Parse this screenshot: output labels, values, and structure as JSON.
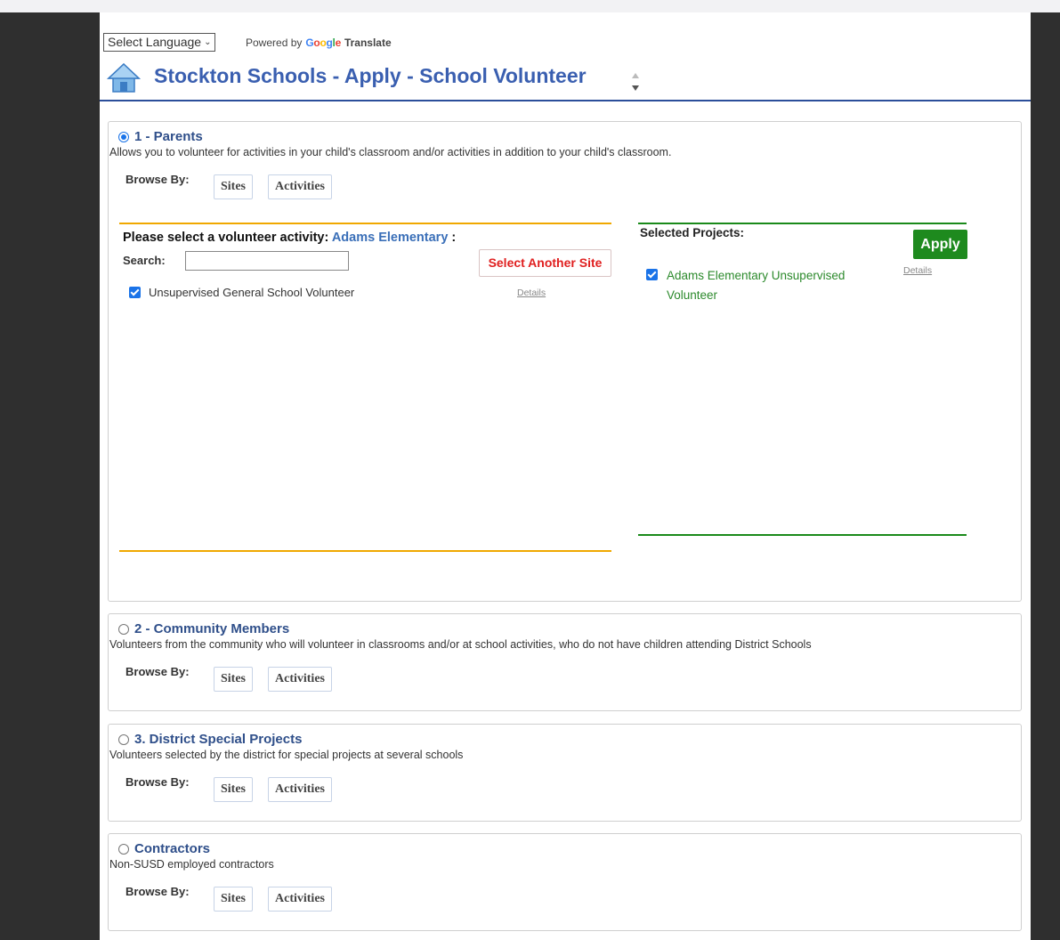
{
  "language": {
    "select_label": "Select Language",
    "powered_by": "Powered by",
    "google": "Google",
    "translate": "Translate"
  },
  "header": {
    "title": "Stockton Schools - Apply - School Volunteer"
  },
  "browse_label": "Browse By:",
  "buttons": {
    "sites": "Sites",
    "activities": "Activities"
  },
  "panels": [
    {
      "title": "1 - Parents",
      "desc": "Allows you to volunteer for activities in your child's classroom and/or activities in addition to your child's classroom.",
      "selected": true
    },
    {
      "title": "2 - Community Members",
      "desc": "Volunteers from the community who will volunteer in classrooms and/or at school activities, who do not have children attending District Schools",
      "selected": false
    },
    {
      "title": "3. District Special Projects",
      "desc": "Volunteers selected by the district for special projects at several schools",
      "selected": false
    },
    {
      "title": "Contractors",
      "desc": "Non-SUSD employed contractors",
      "selected": false
    }
  ],
  "activity_picker": {
    "prompt": "Please select a volunteer activity:",
    "site": "Adams Elementary",
    "colon": ":",
    "search_label": "Search:",
    "search_value": "",
    "select_another": "Select Another Site",
    "items": [
      {
        "label": "Unsupervised General School Volunteer",
        "checked": true,
        "details": "Details"
      }
    ]
  },
  "selected_projects": {
    "title": "Selected Projects:",
    "apply": "Apply",
    "items": [
      {
        "label": "Adams Elementary Unsupervised Volunteer",
        "checked": true,
        "details": "Details"
      }
    ]
  },
  "colors": {
    "title_blue": "#3a5fb0",
    "orange": "#f0a800",
    "green": "#1e8a1e",
    "red": "#e02020"
  }
}
